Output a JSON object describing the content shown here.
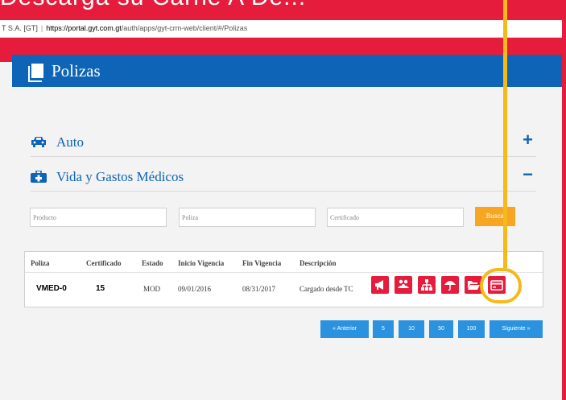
{
  "headline": "Descarga su Carné A Dé...",
  "browser": {
    "site_label": "T S.A. [GT]",
    "url_host": "https://portal.gyt.com.gt",
    "url_path": "/auth/apps/gyt-crm-web/client/#/Polizas"
  },
  "page": {
    "title": "Polizas"
  },
  "sections": [
    {
      "label": "Auto",
      "toggle": "+"
    },
    {
      "label": "Vida y Gastos Médicos",
      "toggle": "−"
    }
  ],
  "filters": {
    "producto_placeholder": "Producto",
    "poliza_placeholder": "Poliza",
    "certificado_placeholder": "Certificado",
    "busca_label": "Busca"
  },
  "table": {
    "headers": [
      "Poliza",
      "Certificado",
      "Estado",
      "Inicio Vigencia",
      "Fin Vigencia",
      "Descripción"
    ],
    "rows": [
      [
        "VMED-0",
        "15",
        "MOD",
        "09/01/2016",
        "08/31/2017",
        "Cargado desde TC"
      ]
    ]
  },
  "actions": [
    "megaphone-icon",
    "people-icon",
    "sitemap-icon",
    "umbrella-icon",
    "folder-open-icon",
    "id-card-icon"
  ],
  "pagination": {
    "prev": "« Anterior",
    "sizes": [
      "5",
      "10",
      "50",
      "100"
    ],
    "next": "Siguiente »"
  },
  "colors": {
    "brand_red": "#e51c3b",
    "brand_blue": "#0e64b6",
    "accent_orange": "#f6a623",
    "highlight": "#f6b91a",
    "pager_blue": "#2a92de"
  }
}
